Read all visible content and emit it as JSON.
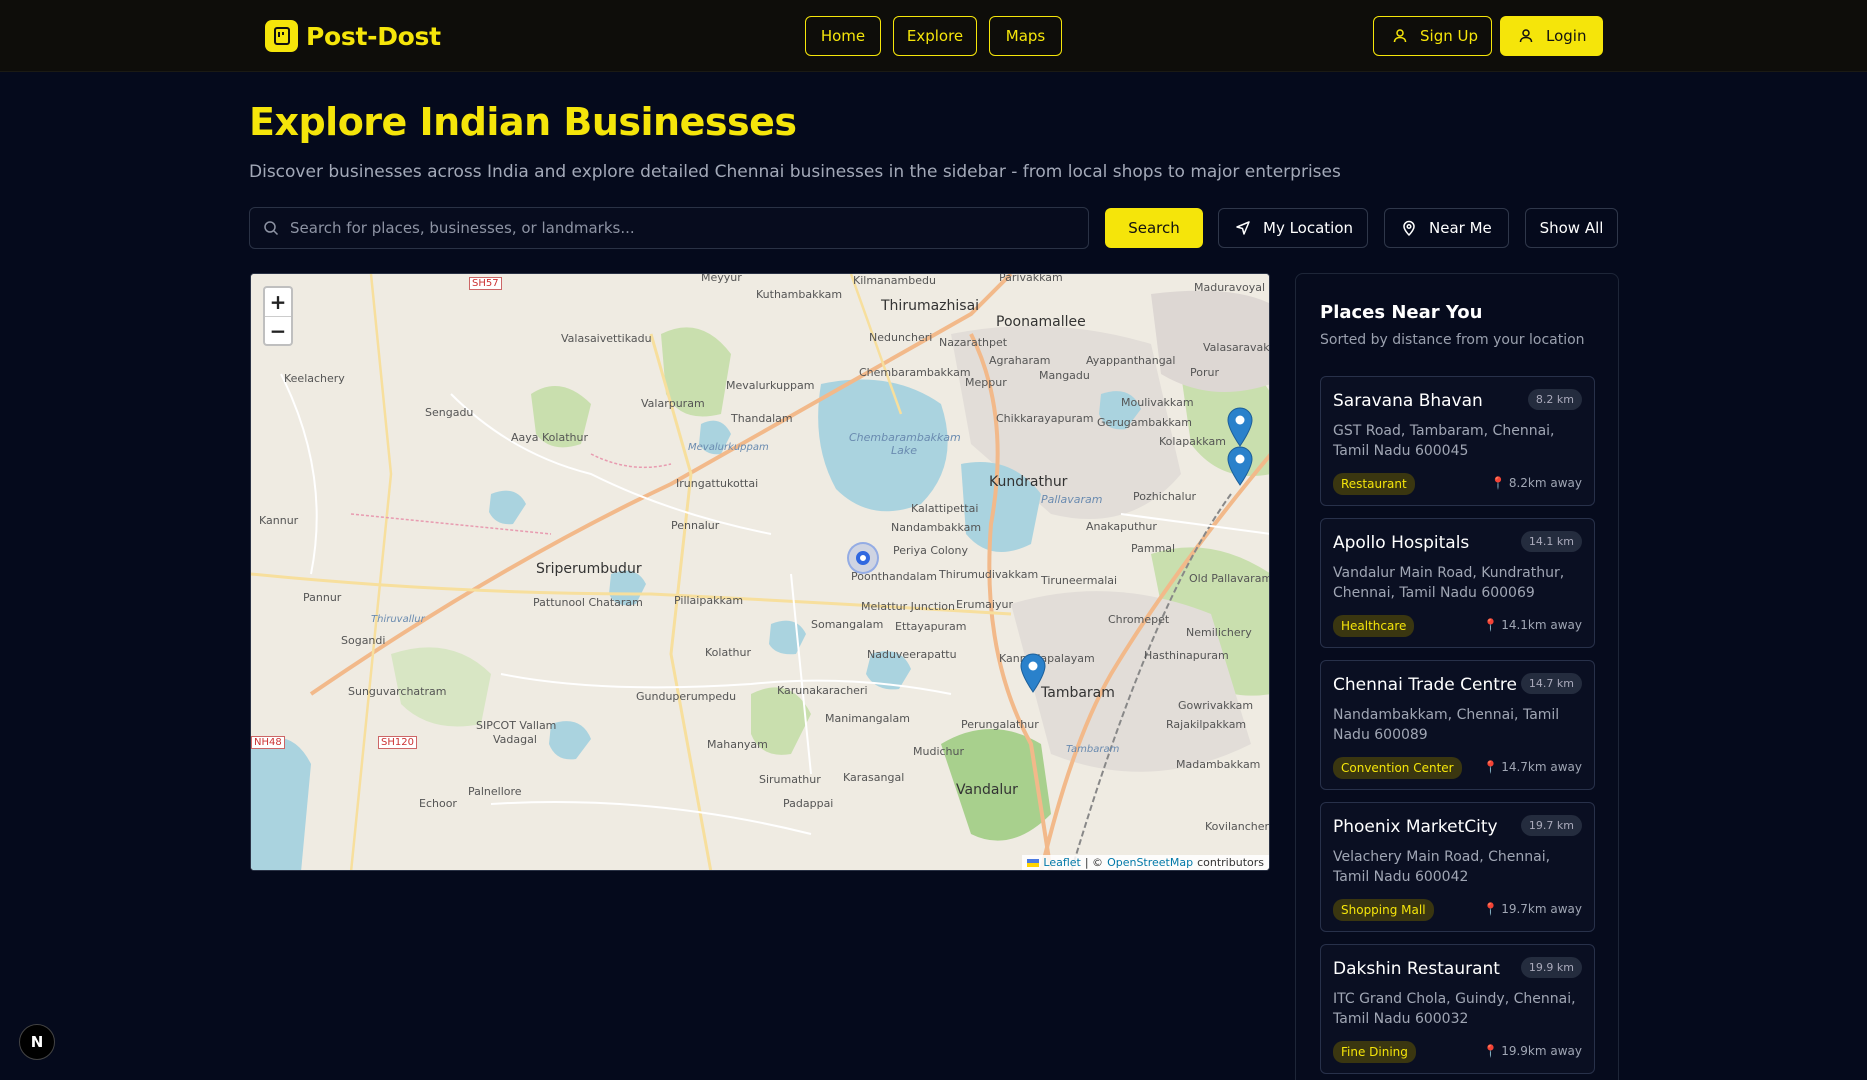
{
  "header": {
    "brand": "Post-Dost",
    "nav": [
      "Home",
      "Explore",
      "Maps"
    ],
    "signup": "Sign Up",
    "login": "Login"
  },
  "hero": {
    "title": "Explore Indian Businesses",
    "subtitle": "Discover businesses across India and explore detailed Chennai businesses in the sidebar - from local shops to major enterprises"
  },
  "search": {
    "placeholder": "Search for places, businesses, or landmarks...",
    "button": "Search",
    "my_location": "My Location",
    "near_me": "Near Me",
    "show_all": "Show All"
  },
  "map": {
    "zoom_in": "+",
    "zoom_out": "−",
    "attribution_leaflet": "Leaflet",
    "attribution_sep": "| ©",
    "attribution_osm": "OpenStreetMap",
    "attribution_tail": "contributors",
    "labels": {
      "thirumazhisai": "Thirumazhisai",
      "poonamallee": "Poonamallee",
      "sriperumbudur": "Sriperumbudur",
      "tambaram": "Tambaram",
      "kundrathur": "Kundrathur",
      "vandalur": "Vandalur",
      "chembarambakkam_lake": "Chembarambakkam Lake",
      "pallavaram": "Pallavaram",
      "chromepet": "Chromepet",
      "perungalathur": "Perungalathur",
      "mudichur": "Mudichur",
      "sipcot": "SIPCOT Vallam",
      "vadagal": "Vadagal",
      "pattunool": "Pattunool Chataram",
      "pillaipakkam": "Pillaipakkam",
      "kolathur": "Kolathur",
      "karasangal": "Karasangal",
      "padappai": "Padappai",
      "sunguvarchatram": "Sunguvarchatram",
      "sogandi": "Sogandi",
      "pannur": "Pannur",
      "kannur": "Kannur",
      "keelachery": "Keelachery",
      "sengadu": "Sengadu",
      "aaya_kolathur": "Aaya Kolathur",
      "valarpuram": "Valarpuram",
      "mevalurkuppam": "Mevalurkuppam",
      "irungattukottai": "Irungattukottai",
      "pennalur": "Pennalur",
      "thandalam": "Thandalam",
      "nandambakkam": "Nandambakkam",
      "periya_colony": "Periya Colony",
      "poonthandalam": "Poonthandalam",
      "melattur": "Melattur Junction",
      "somangalam": "Somangalam",
      "ettayapuram": "Ettayapuram",
      "naduveerapattu": "Naduveerapattu",
      "karunakaracheri": "Karunakaracheri",
      "gunduperumpedu": "Gunduperumpedu",
      "manimangalam": "Manimangalam",
      "mahanyam": "Mahanyam",
      "sirumathur": "Sirumathur",
      "palnellore": "Palnellore",
      "echoor": "Echoor",
      "hasthinapuram": "Hasthinapuram",
      "rajakilpakkam": "Rajakilpakkam",
      "madambakkam": "Madambakkam",
      "gowrivakkam": "Gowrivakkam",
      "nemilichery": "Nemilichery",
      "old_pallavaram": "Old Pallavaram",
      "anakaputhur": "Anakaputhur",
      "pammal": "Pammal",
      "pozhichalur": "Pozhichalur",
      "gerugambakkam": "Gerugambakkam",
      "moulivakkam": "Moulivakkam",
      "porur": "Porur",
      "mangadu": "Mangadu",
      "nazarathpet": "Nazarathpet",
      "chembarambakkam": "Chembarambakkam",
      "kuthambakkam": "Kuthambakkam",
      "kilmanambedu": "Kilmanambedu",
      "valasaravakkam": "Valasaravakkam",
      "maduravoyal": "Maduravoyal",
      "kovilanchery": "Kovilanchery",
      "thirumudivakkam": "Thirumudivakkam",
      "tiruneermalai": "Tiruneermalai",
      "erumaiyur": "Erumaiyur",
      "kalattipettai": "Kalattipettai",
      "sh57": "SH57",
      "sh120": "SH120",
      "nh48": "NH48",
      "kolapakkam": "Kolapakkam",
      "meyyur": "Meyyur",
      "parivakkam": "Parivakkam",
      "valasaivettikadu": "Valasaivettikadu",
      "neduncheri": "Neduncheri",
      "agraharam": "Agraharam",
      "ayappanthangal": "Ayappanthangal",
      "meppur": "Meppur",
      "chikkarayapuram": "Chikkarayapuram",
      "kannadapalayam": "Kannadapalayam",
      "mevalurkuppam_water": "Mevalurkuppam",
      "thiruvallur": "Thiruvallur",
      "tambaram_water": "Tambaram"
    }
  },
  "sidebar": {
    "title": "Places Near You",
    "subtitle": "Sorted by distance from your location",
    "places": [
      {
        "name": "Saravana Bhavan",
        "distance": "8.2 km",
        "address": "GST Road, Tambaram, Chennai, Tamil Nadu 600045",
        "category": "Restaurant",
        "away": "8.2km away"
      },
      {
        "name": "Apollo Hospitals",
        "distance": "14.1 km",
        "address": "Vandalur Main Road, Kundrathur, Chennai, Tamil Nadu 600069",
        "category": "Healthcare",
        "away": "14.1km away"
      },
      {
        "name": "Chennai Trade Centre",
        "distance": "14.7 km",
        "address": "Nandambakkam, Chennai, Tamil Nadu 600089",
        "category": "Convention Center",
        "away": "14.7km away"
      },
      {
        "name": "Phoenix MarketCity",
        "distance": "19.7 km",
        "address": "Velachery Main Road, Chennai, Tamil Nadu 600042",
        "category": "Shopping Mall",
        "away": "19.7km away"
      },
      {
        "name": "Dakshin Restaurant",
        "distance": "19.9 km",
        "address": "ITC Grand Chola, Guindy, Chennai, Tamil Nadu 600032",
        "category": "Fine Dining",
        "away": "19.9km away"
      }
    ]
  },
  "badge": "N",
  "colors": {
    "accent": "#f5e50a",
    "background": "#050a1c",
    "header": "#0e0d0a"
  }
}
